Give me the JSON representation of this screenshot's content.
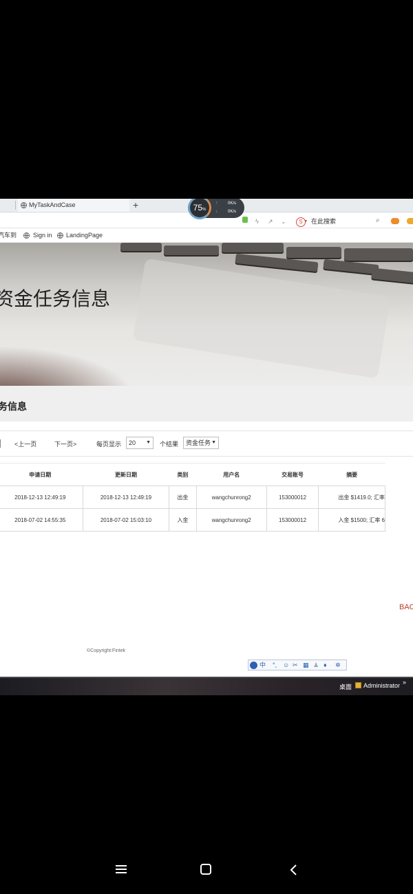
{
  "browser": {
    "tab_title": "MyTaskAndCase",
    "new_tab_symbol": "+",
    "speed": {
      "percent": "75",
      "percent_unit": "%",
      "upload": "0K/s",
      "download": "0K/s"
    },
    "search_placeholder": "在此搜索",
    "bookmarks": [
      "汽车到",
      "Sign in",
      "LandingPage"
    ]
  },
  "hero": {
    "title": "资金任务信息"
  },
  "section": {
    "title": "务信息"
  },
  "pager": {
    "prev": "<上一页",
    "next": "下一页>",
    "per_page_label": "每页显示",
    "per_page_value": "20",
    "results_label": "个结果",
    "type_value": "资金任务"
  },
  "table": {
    "headers": [
      "申请日期",
      "更新日期",
      "类别",
      "用户名",
      "交易账号",
      "摘要"
    ],
    "rows": [
      [
        "2018-12-13 12:49:19",
        "2018-12-13 12:49:19",
        "出金",
        "wangchunrong2",
        "153000012",
        "出金 $1419.0; 汇率"
      ],
      [
        "2018-07-02 14:55:35",
        "2018-07-02 15:03:10",
        "入金",
        "wangchunrong2",
        "153000012",
        "入金 $1500; 汇率 6"
      ]
    ]
  },
  "back_link": "BAC",
  "copyright": "©Copyright:Fintek",
  "ime": {
    "mode": "中"
  },
  "taskbar": {
    "desktop": "桌面",
    "user": "Administrator",
    "more": "»"
  },
  "colors": {
    "accent_red": "#c0392b",
    "ime_blue": "#2b62b5"
  }
}
